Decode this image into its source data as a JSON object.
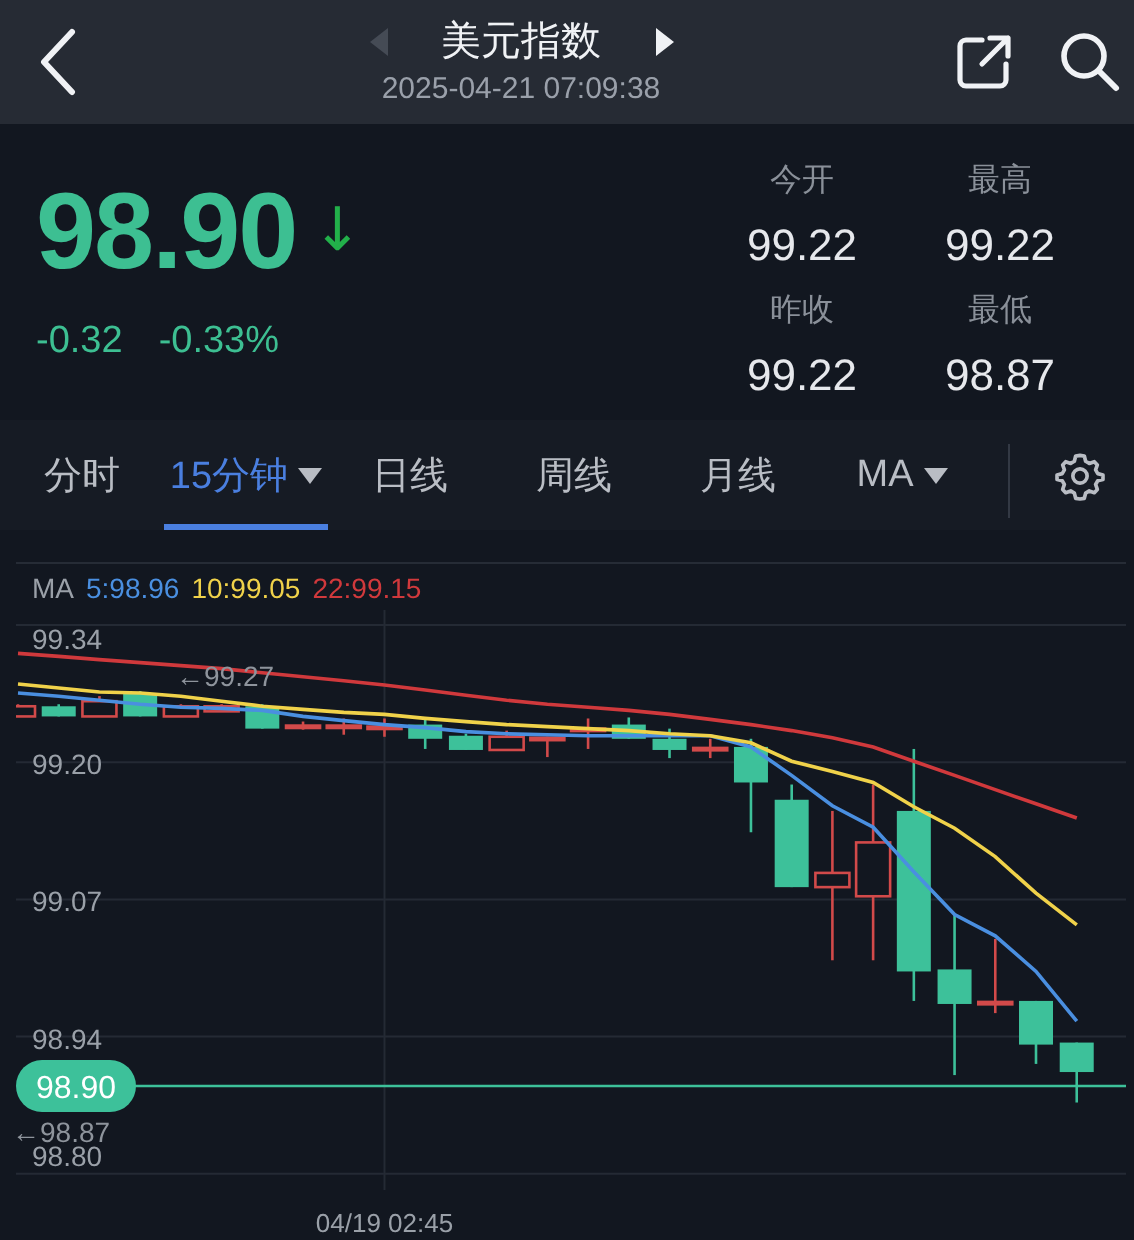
{
  "header": {
    "title": "美元指数",
    "timestamp": "2025-04-21 07:09:38",
    "prev_disabled": true,
    "next_disabled": false
  },
  "quote": {
    "price": "98.90",
    "arrow": "↓",
    "change": "-0.32",
    "change_percent": "-0.33%",
    "stats": [
      {
        "label": "今开",
        "value": "99.22"
      },
      {
        "label": "最高",
        "value": "99.22"
      },
      {
        "label": "昨收",
        "value": "99.22"
      },
      {
        "label": "最低",
        "value": "98.87"
      }
    ]
  },
  "tabs": [
    {
      "label": "分时",
      "selected": false,
      "dropdown": false
    },
    {
      "label": "15分钟",
      "selected": true,
      "dropdown": true
    },
    {
      "label": "日线",
      "selected": false,
      "dropdown": false
    },
    {
      "label": "周线",
      "selected": false,
      "dropdown": false
    },
    {
      "label": "月线",
      "selected": false,
      "dropdown": false
    },
    {
      "label": "MA",
      "selected": false,
      "dropdown": true
    }
  ],
  "chart": {
    "legend": {
      "label": "MA",
      "items": [
        {
          "text": "5:98.96",
          "color": "#4a8fe0"
        },
        {
          "text": "10:99.05",
          "color": "#f0d24a"
        },
        {
          "text": "22:99.15",
          "color": "#d0393c"
        }
      ]
    },
    "y_axis_labels": [
      "99.34",
      "99.20",
      "99.07",
      "98.94",
      "98.80"
    ],
    "time_label": "04/19 02:45",
    "high_marker": "←99.27",
    "low_marker": "←98.87",
    "price_tag": "98.90"
  }
}
